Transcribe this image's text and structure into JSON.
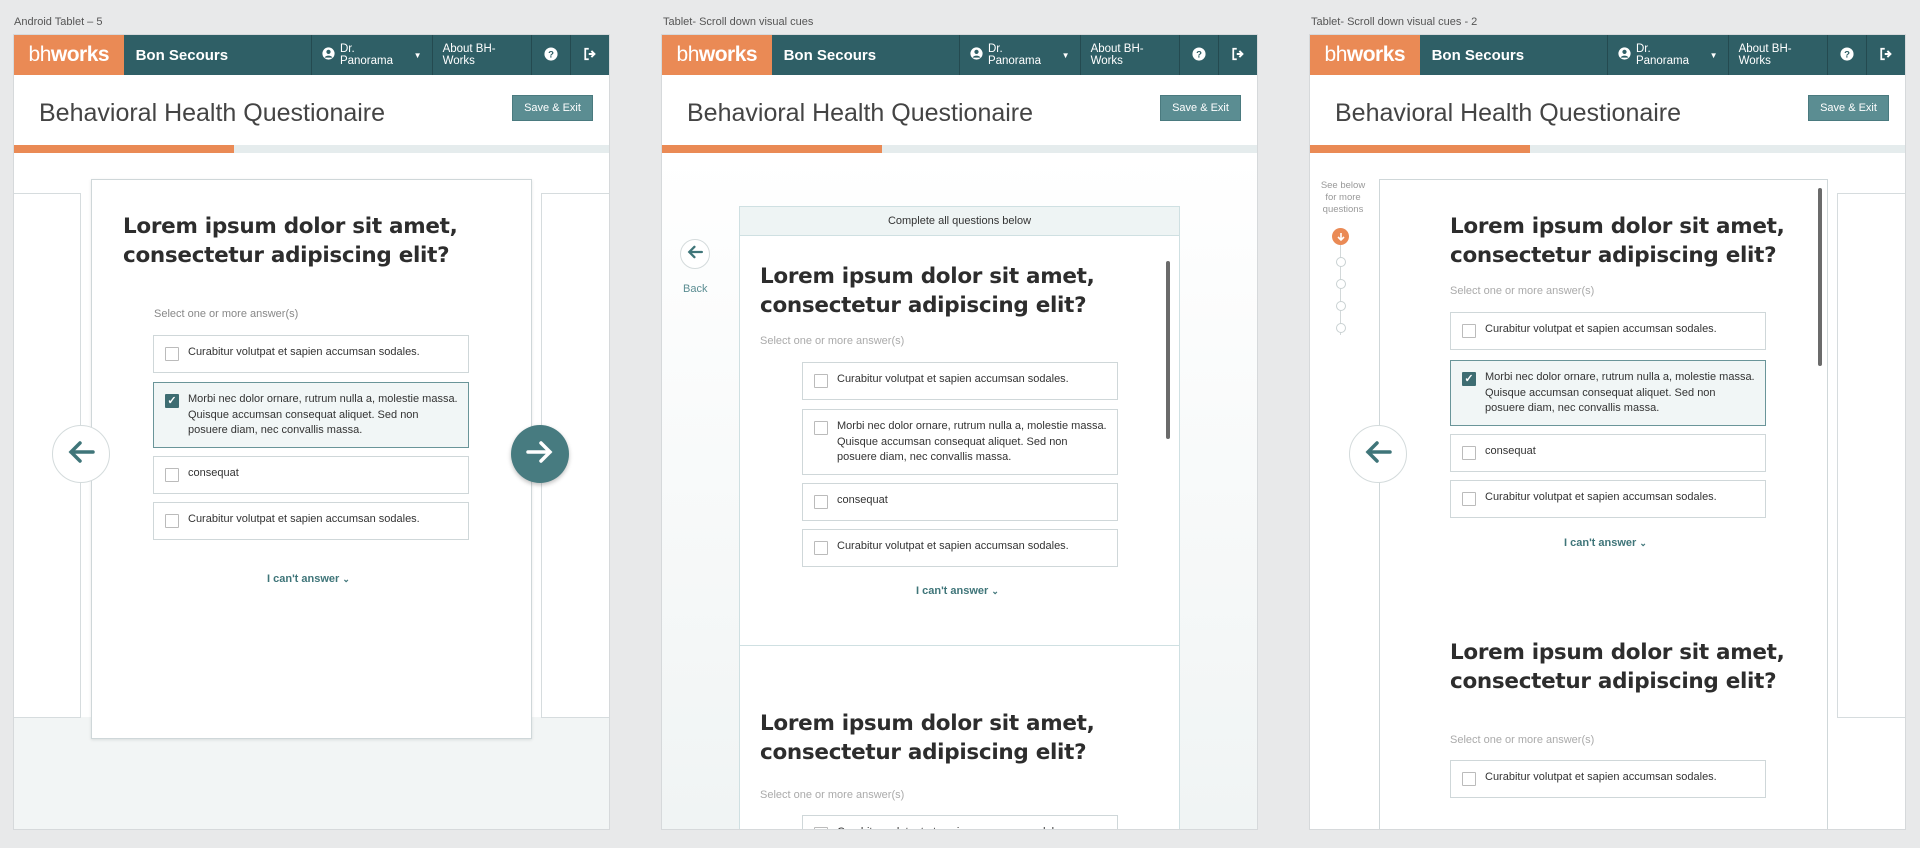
{
  "frames": [
    {
      "label": "Android Tablet – 5"
    },
    {
      "label": "Tablet- Scroll down visual cues"
    },
    {
      "label": "Tablet- Scroll down visual cues - 2"
    }
  ],
  "nav": {
    "logo_bh": "bh",
    "logo_works": "works",
    "org": "Bon Secours",
    "user": "Dr. Panorama",
    "about": "About BH-Works",
    "help_icon": "question-circle-icon",
    "logout_icon": "sign-out-icon"
  },
  "page": {
    "title": "Behavioral Health Questionaire",
    "save_label": "Save & Exit",
    "progress_percent": 37
  },
  "question": {
    "title_line1": "Lorem ipsum dolor sit amet,",
    "title_line2": "consectetur adipiscing elit?",
    "instruction": "Select one or more answer(s)",
    "options": [
      {
        "text": "Curabitur volutpat et sapien accumsan sodales.",
        "checked": false
      },
      {
        "text": "Morbi nec dolor ornare, rutrum nulla a, molestie massa. Quisque accumsan consequat aliquet. Sed non posuere diam, nec convallis massa.",
        "checked": true
      },
      {
        "text": "consequat",
        "checked": false
      },
      {
        "text": "Curabitur volutpat et sapien accumsan sodales.",
        "checked": false
      }
    ],
    "cant_answer": "I can't answer"
  },
  "frame2": {
    "banner": "Complete all questions below",
    "back_label": "Back"
  },
  "frame3": {
    "hint": "See below for more questions"
  },
  "colors": {
    "brand_orange": "#ea8a55",
    "brand_teal": "#2f5f66",
    "accent": "#5b8d92"
  }
}
